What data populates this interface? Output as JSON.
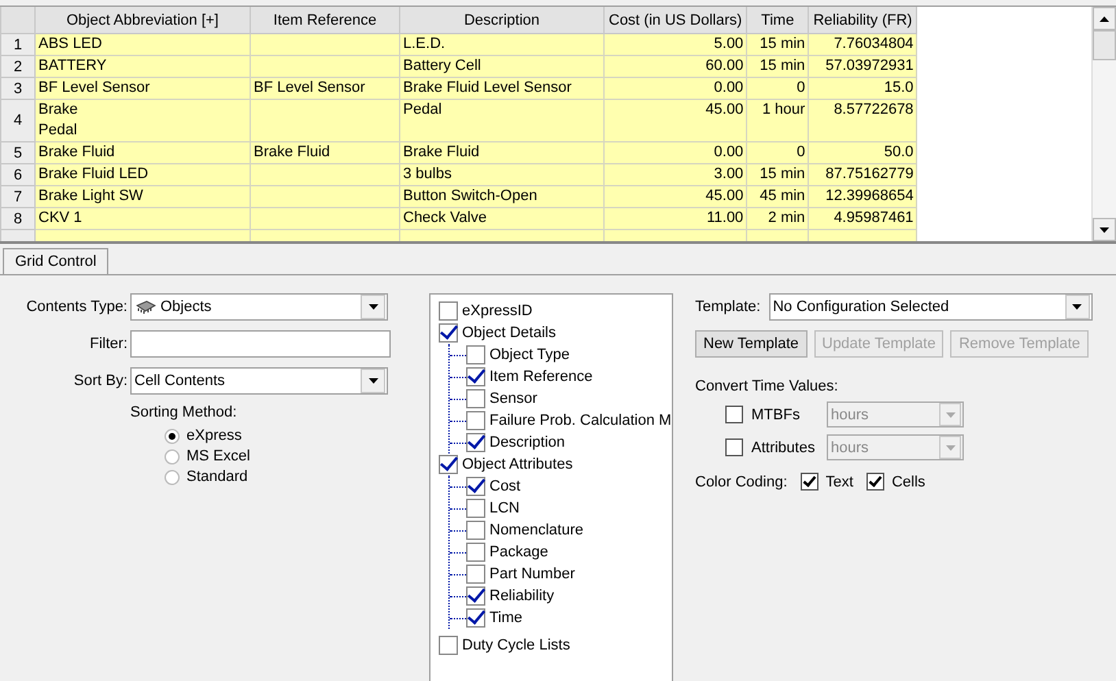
{
  "grid": {
    "columns": [
      "Object Abbreviation [+]",
      "Item Reference",
      "Description",
      "Cost (in US Dollars)",
      "Time",
      "Reliability (FR)"
    ],
    "rows": [
      {
        "number": "1",
        "cells": [
          "ABS LED",
          "",
          "L.E.D.",
          "5.00",
          "15 min",
          "7.76034804"
        ]
      },
      {
        "number": "2",
        "cells": [
          "BATTERY",
          "",
          "Battery Cell",
          "60.00",
          "15 min",
          "57.03972931"
        ]
      },
      {
        "number": "3",
        "cells": [
          "BF Level Sensor",
          "BF Level Sensor",
          "Brake Fluid Level Sensor",
          "0.00",
          "0",
          "15.0"
        ]
      },
      {
        "number": "4",
        "cells": [
          "Brake\nPedal",
          "",
          "Pedal",
          "45.00",
          "1 hour",
          "8.57722678"
        ]
      },
      {
        "number": "5",
        "cells": [
          "Brake Fluid",
          "Brake Fluid",
          "Brake Fluid",
          "0.00",
          "0",
          "50.0"
        ]
      },
      {
        "number": "6",
        "cells": [
          "Brake Fluid LED",
          "",
          "3 bulbs",
          "3.00",
          "15 min",
          "87.75162779"
        ]
      },
      {
        "number": "7",
        "cells": [
          "Brake Light SW",
          "",
          "Button Switch-Open",
          "45.00",
          "45 min",
          "12.39968654"
        ]
      },
      {
        "number": "8",
        "cells": [
          "CKV 1",
          "",
          "Check Valve",
          "11.00",
          "2 min",
          "4.95987461"
        ]
      }
    ]
  },
  "tabs": [
    {
      "label": "Grid Control",
      "selected": true
    }
  ],
  "contents_type": {
    "label": "Contents Type:",
    "value": "Objects"
  },
  "filter": {
    "label": "Filter:"
  },
  "sort_by": {
    "label": "Sort By:",
    "value": "Cell Contents"
  },
  "sorting_method": {
    "label": "Sorting Method:",
    "options": [
      {
        "label": "eXpress",
        "selected": true
      },
      {
        "label": "MS Excel",
        "selected": false
      },
      {
        "label": "Standard",
        "selected": false
      }
    ]
  },
  "fields_tree": [
    {
      "label": "eXpressID",
      "checked": false
    },
    {
      "label": "Object Details",
      "checked": true,
      "children": [
        {
          "label": "Object Type",
          "checked": false
        },
        {
          "label": "Item Reference",
          "checked": true
        },
        {
          "label": "Sensor",
          "checked": false
        },
        {
          "label": "Failure Prob. Calculation M",
          "checked": false
        },
        {
          "label": "Description",
          "checked": true
        }
      ]
    },
    {
      "label": "Object Attributes",
      "checked": true,
      "children": [
        {
          "label": "Cost",
          "checked": true
        },
        {
          "label": "LCN",
          "checked": false
        },
        {
          "label": "Nomenclature",
          "checked": false
        },
        {
          "label": "Package",
          "checked": false
        },
        {
          "label": "Part Number",
          "checked": false
        },
        {
          "label": "Reliability",
          "checked": true
        },
        {
          "label": "Time",
          "checked": true
        }
      ]
    },
    {
      "label": "Duty Cycle Lists",
      "checked": false
    }
  ],
  "template": {
    "label": "Template:",
    "value": "No Configuration Selected"
  },
  "template_buttons": [
    {
      "label": "New Template",
      "disabled": false
    },
    {
      "label": "Update Template",
      "disabled": true
    },
    {
      "label": "Remove Template",
      "disabled": true
    }
  ],
  "convert_time": {
    "label": "Convert Time Values:",
    "rows": [
      {
        "label": "MTBFs",
        "checked": false,
        "unit": "hours",
        "disabled": true
      },
      {
        "label": "Attributes",
        "checked": false,
        "unit": "hours",
        "disabled": true
      }
    ]
  },
  "color_coding": {
    "label": "Color Coding:",
    "options": [
      {
        "label": "Text",
        "checked": true
      },
      {
        "label": "Cells",
        "checked": true
      }
    ]
  }
}
